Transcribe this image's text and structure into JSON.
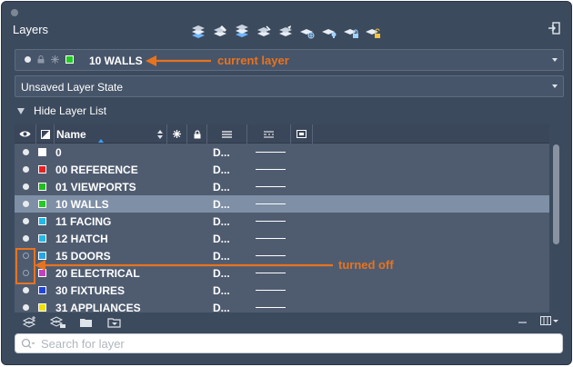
{
  "panel": {
    "title": "Layers"
  },
  "current_layer": {
    "name": "10 WALLS",
    "color": "#22cc22"
  },
  "layer_state": {
    "value": "Unsaved Layer State"
  },
  "layer_list_toggle": {
    "label": "Hide Layer List"
  },
  "columns": {
    "name": "Name"
  },
  "layers": [
    {
      "name": "0",
      "color": "#ffffff",
      "on": true,
      "linetype": "D..."
    },
    {
      "name": "00 REFERENCE",
      "color": "#e82020",
      "on": true,
      "linetype": "D..."
    },
    {
      "name": "01 VIEWPORTS",
      "color": "#22bb22",
      "on": true,
      "linetype": "D..."
    },
    {
      "name": "10 WALLS",
      "color": "#22cc22",
      "on": true,
      "linetype": "D...",
      "selected": true
    },
    {
      "name": "11 FACING",
      "color": "#22b8e8",
      "on": true,
      "linetype": "D..."
    },
    {
      "name": "12 HATCH",
      "color": "#22b8e8",
      "on": true,
      "linetype": "D..."
    },
    {
      "name": "15 DOORS",
      "color": "#22a8e8",
      "on": false,
      "linetype": "D..."
    },
    {
      "name": "20 ELECTRICAL",
      "color": "#c040c0",
      "on": false,
      "linetype": "D..."
    },
    {
      "name": "30 FIXTURES",
      "color": "#2244dd",
      "on": true,
      "linetype": "D..."
    },
    {
      "name": "31 APPLIANCES",
      "color": "#f0e000",
      "on": true,
      "linetype": "D..."
    }
  ],
  "search": {
    "placeholder": "Search for layer"
  },
  "annotations": {
    "current": "current layer",
    "off": "turned off",
    "accent": "#e8731e"
  },
  "icons": [
    "exit-icon",
    "layer-tool-icons",
    "bulb-icon",
    "lock-icon",
    "freeze-icon",
    "search-icon",
    "folder-icon"
  ]
}
